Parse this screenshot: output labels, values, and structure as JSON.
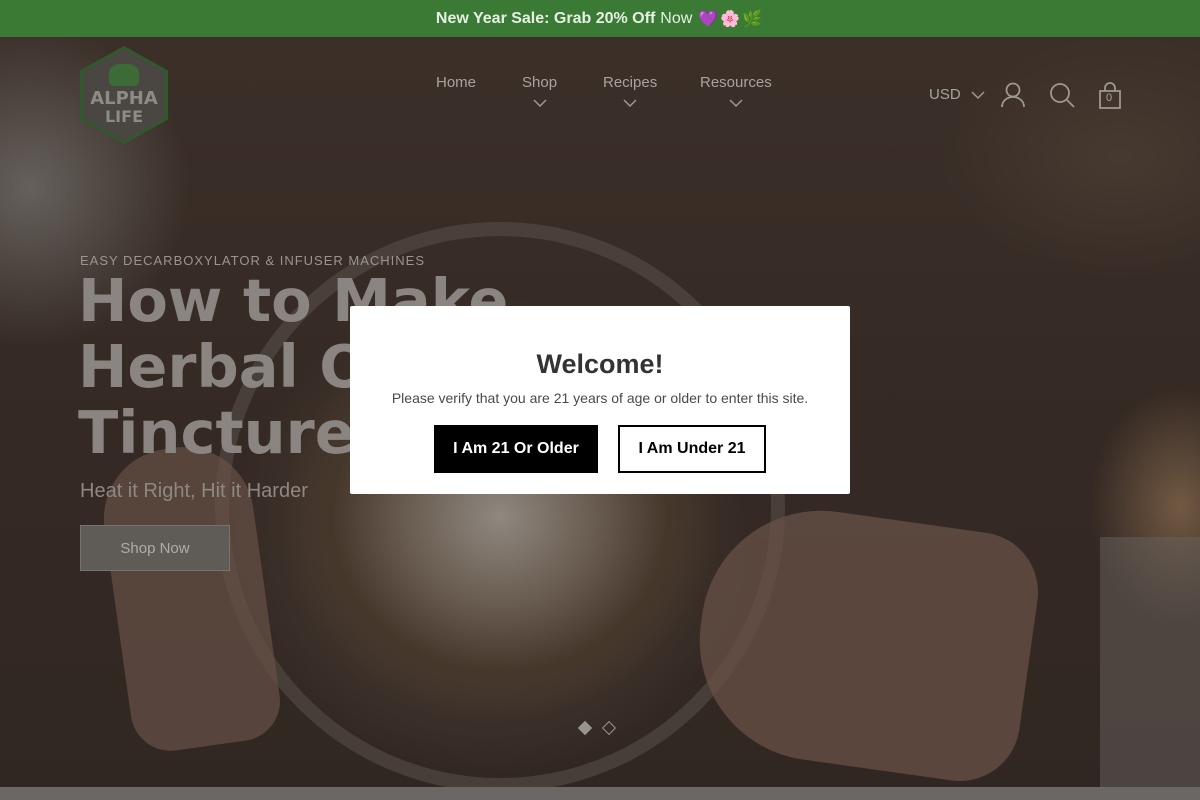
{
  "announcement": {
    "bold_text": "New Year Sale: Grab 20% Off",
    "regular_text": "Now",
    "emoji": "💜🌸🌿"
  },
  "logo": {
    "line1": "ALPHA",
    "line2": "LIFE"
  },
  "nav": {
    "items": [
      {
        "label": "Home",
        "has_dropdown": false
      },
      {
        "label": "Shop",
        "has_dropdown": true
      },
      {
        "label": "Recipes",
        "has_dropdown": true
      },
      {
        "label": "Resources",
        "has_dropdown": true
      }
    ]
  },
  "header": {
    "currency": "USD",
    "cart_count": "0",
    "icons": [
      "account-icon",
      "search-icon",
      "cart-icon"
    ]
  },
  "hero": {
    "eyebrow": "EASY DECARBOXYLATOR & INFUSER MACHINES",
    "headline": "How to Make Herbal Oil, Tinctures",
    "subhead": "Heat it Right, Hit it Harder",
    "cta": "Shop Now",
    "slides": 2,
    "active_slide": 1
  },
  "modal": {
    "title": "Welcome!",
    "message": "Please verify that you are 21 years of age or older to enter this site.",
    "confirm_label": "I Am 21 Or Older",
    "deny_label": "I Am Under 21"
  },
  "colors": {
    "announcement_bg": "#3b7a34",
    "overlay": "#2b2622",
    "modal_bg": "#ffffff",
    "primary_button": "#000000"
  }
}
